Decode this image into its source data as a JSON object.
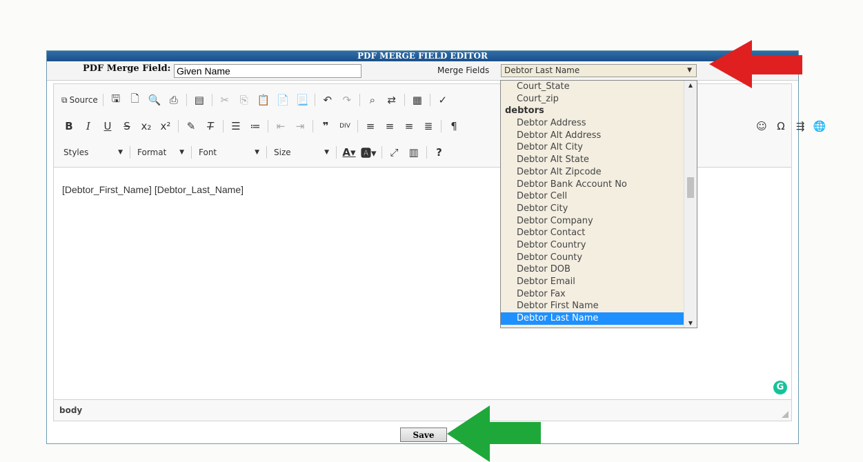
{
  "dialog": {
    "title": "PDF MERGE FIELD EDITOR",
    "field_label": "PDF Merge Field:",
    "field_value": "Given Name",
    "merge_fields_label": "Merge Fields",
    "merge_fields_selected": "Debtor Last Name"
  },
  "toolbar": {
    "source_label": "Source",
    "styles_label": "Styles",
    "format_label": "Format",
    "font_label": "Font",
    "size_label": "Size"
  },
  "editor": {
    "content": "[Debtor_First_Name] [Debtor_Last_Name]",
    "status_path": "body"
  },
  "dropdown": {
    "options": [
      {
        "label": "Court_State",
        "group": false
      },
      {
        "label": "Court_zip",
        "group": false
      },
      {
        "label": "debtors",
        "group": true
      },
      {
        "label": "Debtor Address",
        "group": false
      },
      {
        "label": "Debtor Alt Address",
        "group": false
      },
      {
        "label": "Debtor Alt City",
        "group": false
      },
      {
        "label": "Debtor Alt State",
        "group": false
      },
      {
        "label": "Debtor Alt Zipcode",
        "group": false
      },
      {
        "label": "Debtor Bank Account No",
        "group": false
      },
      {
        "label": "Debtor Cell",
        "group": false
      },
      {
        "label": "Debtor City",
        "group": false
      },
      {
        "label": "Debtor Company",
        "group": false
      },
      {
        "label": "Debtor Contact",
        "group": false
      },
      {
        "label": "Debtor Country",
        "group": false
      },
      {
        "label": "Debtor County",
        "group": false
      },
      {
        "label": "Debtor DOB",
        "group": false
      },
      {
        "label": "Debtor Email",
        "group": false
      },
      {
        "label": "Debtor Fax",
        "group": false
      },
      {
        "label": "Debtor First Name",
        "group": false
      },
      {
        "label": "Debtor Last Name",
        "group": false,
        "selected": true
      }
    ]
  },
  "save_label": "Save",
  "colors": {
    "title_bar": "#1b5089",
    "dropdown_bg": "#f3eee0",
    "selected_option": "#1e90ff",
    "annotation_red": "#e02020",
    "annotation_green": "#1ea83a",
    "grammarly": "#15c39a"
  }
}
